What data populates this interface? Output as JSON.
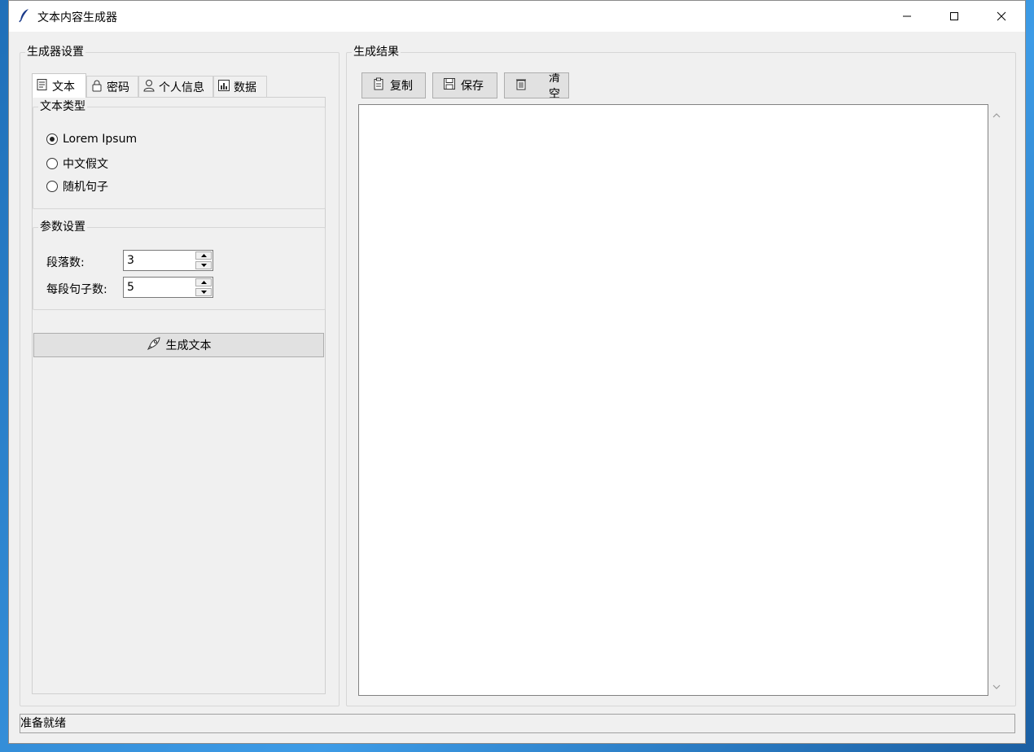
{
  "window": {
    "title": "文本内容生成器",
    "icon": "feather-icon",
    "controls": [
      "minimize",
      "maximize",
      "close"
    ]
  },
  "settings": {
    "group_title": "生成器设置",
    "tabs": [
      {
        "label": "文本",
        "icon": "text-doc-icon",
        "active": true
      },
      {
        "label": "密码",
        "icon": "lock-icon",
        "active": false
      },
      {
        "label": "个人信息",
        "icon": "person-icon",
        "active": false
      },
      {
        "label": "数据",
        "icon": "bar-chart-icon",
        "active": false
      }
    ],
    "text_type": {
      "title": "文本类型",
      "options": [
        {
          "label": "Lorem Ipsum",
          "checked": true
        },
        {
          "label": "中文假文",
          "checked": false
        },
        {
          "label": "随机句子",
          "checked": false
        }
      ]
    },
    "params": {
      "title": "参数设置",
      "paragraphs_label": "段落数:",
      "paragraphs_value": "3",
      "sentences_label": "每段句子数:",
      "sentences_value": "5"
    },
    "generate_label": "生成文本",
    "generate_icon": "rocket-icon"
  },
  "result": {
    "group_title": "生成结果",
    "toolbar": {
      "copy_label": "复制",
      "save_label": "保存",
      "clear_label": "清空"
    },
    "content": ""
  },
  "status": {
    "text": "准备就绪"
  }
}
